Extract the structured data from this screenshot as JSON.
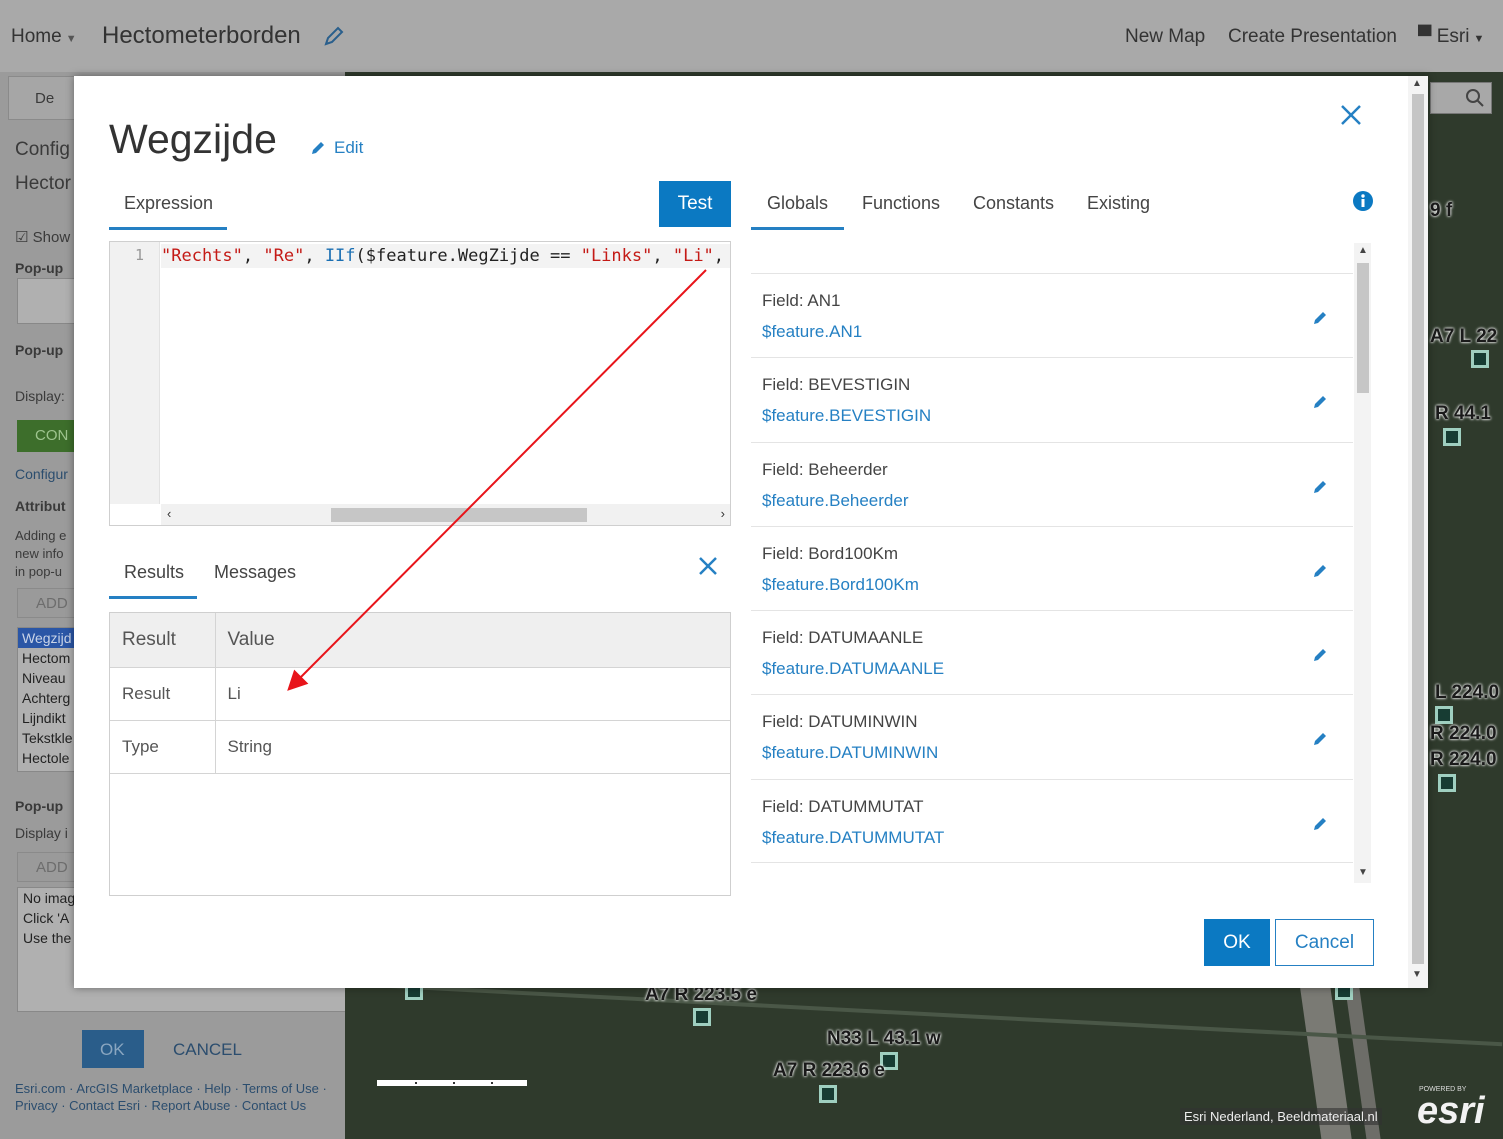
{
  "topbar": {
    "home": "Home",
    "map_title": "Hectometerborden",
    "new_map": "New Map",
    "create_presentation": "Create Presentation",
    "user": "Esri"
  },
  "left_panel": {
    "details_tab": "De",
    "config": "Config",
    "hector": "Hector",
    "show": "Show",
    "popup1": "Pop-up",
    "popup2": "Pop-up",
    "display": "Display:",
    "con_button": "CON",
    "configure": "Configur",
    "attribute": "Attribut",
    "adding_text": [
      "Adding e",
      "new info",
      "in pop-u"
    ],
    "add_button": "ADD",
    "fields": [
      "Wegzijd",
      "Hectom",
      "Niveau",
      "Achterg",
      "Lijndikt",
      "Tekstkle",
      "Hectole"
    ],
    "popup3": "Pop-up",
    "display2": "Display i",
    "add_button2": "ADD",
    "media_text": [
      "No imag",
      "Click 'A",
      "Use the"
    ],
    "ok": "OK",
    "cancel": "CANCEL",
    "footer": "Esri.com · ArcGIS Marketplace · Help · Terms of Use · Privacy · Contact Esri · Report Abuse · Contact Us"
  },
  "map": {
    "labels": [
      "9 f",
      "A7 L 22",
      "R 44.1",
      "L 224.0",
      "R 224.0",
      "R 224.0",
      "A7 R 223.5 e",
      "N33 L 43.1 w",
      "A7 R 223.6 e"
    ],
    "attribution": "Esri Nederland, Beeldmateriaal.nl",
    "logo": "esri",
    "powered": "POWERED BY"
  },
  "modal": {
    "title": "Wegzijde",
    "edit_label": "Edit",
    "tabs": {
      "expression": "Expression",
      "globals": "Globals",
      "functions": "Functions",
      "constants": "Constants",
      "existing": "Existing"
    },
    "test_button": "Test",
    "editor": {
      "line_number": "1",
      "code": {
        "s1": "\"Rechts\"",
        "c1": ", ",
        "s2": "\"Re\"",
        "c2": ", ",
        "k1": "IIf",
        "c3": "($feature.WegZijde == ",
        "s3": "\"Links\"",
        "c4": ", ",
        "s4": "\"Li\"",
        "c5": ","
      }
    },
    "result_tabs": {
      "results": "Results",
      "messages": "Messages"
    },
    "results_table": {
      "headers": [
        "Result",
        "Value"
      ],
      "rows": [
        [
          "Result",
          "Li"
        ],
        [
          "Type",
          "String"
        ]
      ]
    },
    "globals": [
      {
        "label": "Field: AN1",
        "value": "$feature.AN1"
      },
      {
        "label": "Field: BEVESTIGIN",
        "value": "$feature.BEVESTIGIN"
      },
      {
        "label": "Field: Beheerder",
        "value": "$feature.Beheerder"
      },
      {
        "label": "Field: Bord100Km",
        "value": "$feature.Bord100Km"
      },
      {
        "label": "Field: DATUMAANLE",
        "value": "$feature.DATUMAANLE"
      },
      {
        "label": "Field: DATUMINWIN",
        "value": "$feature.DATUMINWIN"
      },
      {
        "label": "Field: DATUMMUTAT",
        "value": "$feature.DATUMMUTAT"
      }
    ],
    "ok": "OK",
    "cancel": "Cancel"
  },
  "colors": {
    "accent": "#0b79c2",
    "link": "#2580c3",
    "string_literal": "#c41a16",
    "annotation_arrow": "#e8141a"
  }
}
